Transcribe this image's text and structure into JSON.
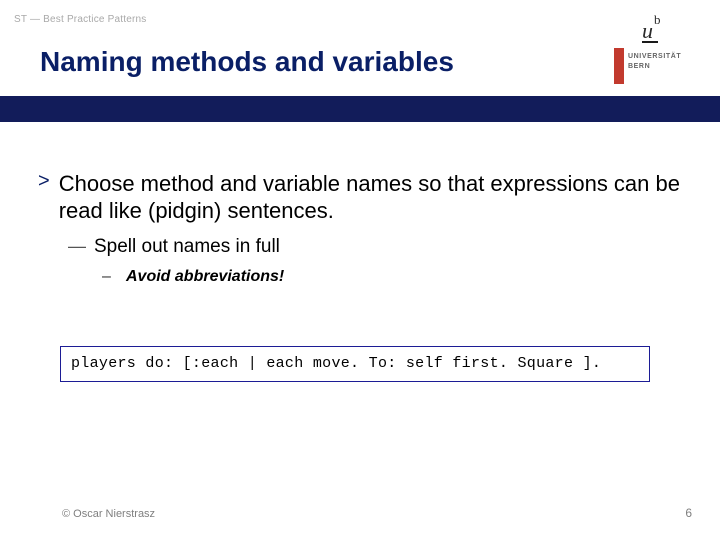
{
  "header": {
    "breadcrumb": "ST — Best Practice Patterns",
    "title": "Naming methods and variables"
  },
  "logo": {
    "u": "u",
    "b": "b",
    "line1": "UNIVERSITÄT",
    "line2": "BERN"
  },
  "bullets": {
    "lvl1_marker": ">",
    "lvl1_text": "Choose method and variable names so that expressions can be read like (pidgin) sentences.",
    "lvl2_marker": "—",
    "lvl2_text": "Spell out names in full",
    "lvl3_marker": "–",
    "lvl3_text": "Avoid abbreviations!"
  },
  "code": "players do: [:each | each move. To: self first. Square ].",
  "footer": {
    "copyright": "© Oscar Nierstrasz",
    "page": "6"
  }
}
